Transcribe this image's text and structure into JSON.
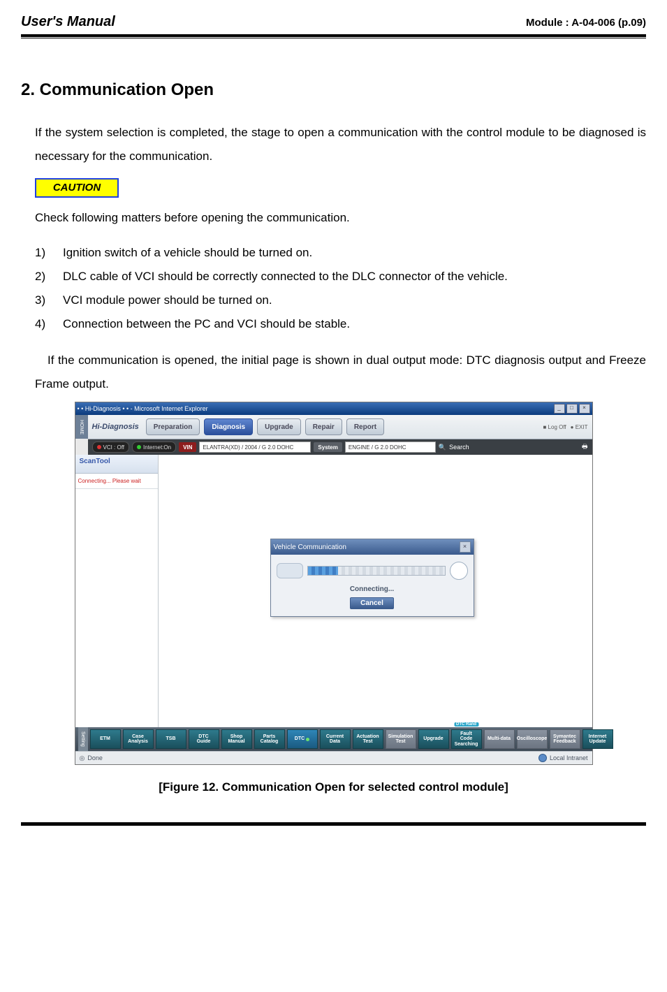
{
  "header": {
    "left": "User's Manual",
    "right": "Module : A-04-006 (p.09)"
  },
  "section_title": "2. Communication Open",
  "para1": "If the system selection is completed, the stage to open a communication with the control module to be diagnosed is necessary for the communication.",
  "caution_label": "CAUTION",
  "para2": "Check following matters before opening the communication.",
  "checklist": [
    {
      "num": "1)",
      "text": "Ignition switch of a vehicle should be turned on."
    },
    {
      "num": "2)",
      "text": "DLC cable of VCI should be correctly connected to the DLC connector of the vehicle."
    },
    {
      "num": "3)",
      "text": "VCI module power should be turned on."
    },
    {
      "num": "4)",
      "text": "Connection between the PC and VCI should be stable."
    }
  ],
  "para3": "If the communication is opened, the initial page is shown in dual output mode: DTC diagnosis output and Freeze Frame output.",
  "figure": {
    "ie_title": "• • Hi-Diagnosis • • - Microsoft Internet Explorer",
    "home": "HOME",
    "logo_a": "Hi-",
    "logo_b": "Diagnosis",
    "nav": {
      "preparation": "Preparation",
      "diagnosis": "Diagnosis",
      "upgrade": "Upgrade",
      "repair": "Repair",
      "report": "Report"
    },
    "acct_logoff": "■ Log Off",
    "acct_exit": "● EXIT",
    "sub": {
      "vci_status": "VCI : Off",
      "net_status": "Internet:On",
      "vin_label": "VIN",
      "vin_value": "ELANTRA(XD) / 2004 / G 2.0 DOHC",
      "system_label": "System",
      "system_value": "ENGINE / G 2.0 DOHC",
      "search": "Search"
    },
    "side": {
      "title": "ScanTool",
      "conn": "Connecting... Please wait"
    },
    "dialog": {
      "title": "Vehicle Communication",
      "msg": "Connecting...",
      "cancel": "Cancel"
    },
    "footer": {
      "setting": "Setting",
      "etm": "ETM",
      "case": "Case\nAnalysis",
      "tsb": "TSB",
      "dtcg": "DTC\nGuide",
      "shop": "Shop\nManual",
      "parts": "Parts\nCatalog",
      "dtc": "DTC",
      "curr": "Current\nData",
      "act": "Actuation\nTest",
      "sim": "Simulation\nTest",
      "upg": "Upgrade",
      "dtcrand_top": "DTC Rand",
      "dtcrand": "Fault Code\nSearching",
      "multi": "Multi-data",
      "osc": "Oscilloscope",
      "feed": "Symantec\nFeedback",
      "iupd": "Internet\nUpdate"
    },
    "status": {
      "done": "Done",
      "zone": "Local Intranet"
    }
  },
  "caption": "[Figure 12. Communication Open for selected control module]"
}
